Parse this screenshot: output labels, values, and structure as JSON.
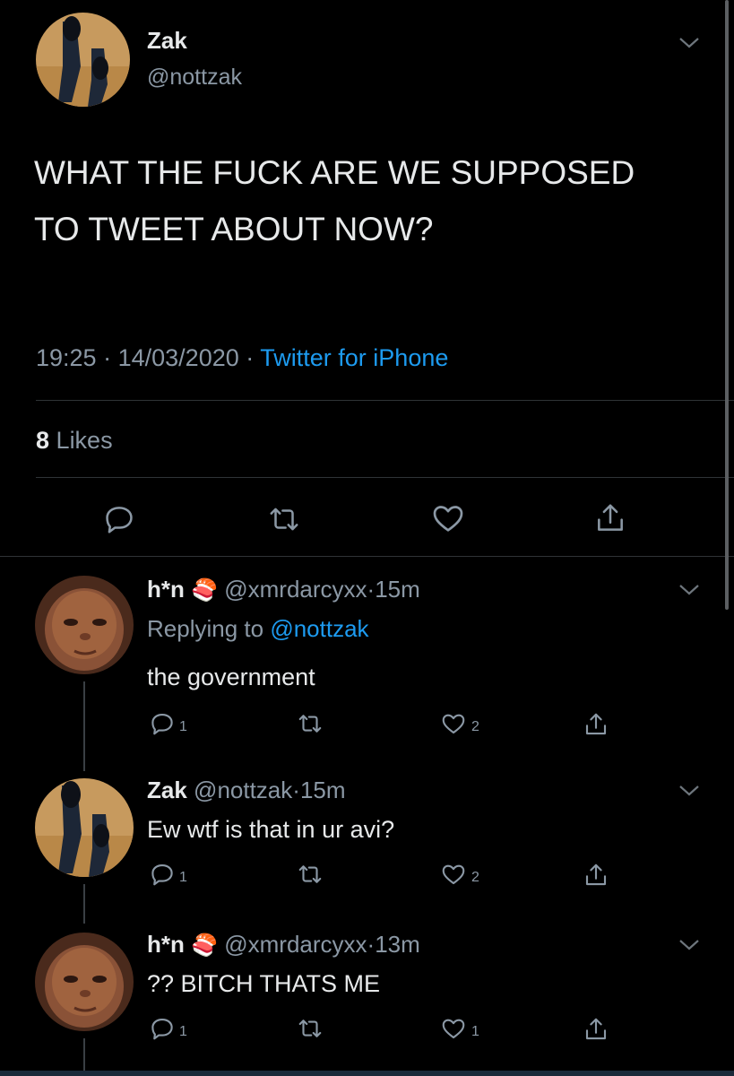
{
  "main_tweet": {
    "display_name": "Zak",
    "handle": "@nottzak",
    "text_line1": "WHAT THE FUCK ARE WE SUPPOSED",
    "text_line2": "TO TWEET ABOUT NOW?",
    "time": "19:25",
    "sep1": "·",
    "date": "14/03/2020",
    "sep2": "·",
    "source": "Twitter for iPhone",
    "likes_count": "8",
    "likes_label": "Likes"
  },
  "replies": [
    {
      "display_name": "h*n",
      "emoji": "🍣",
      "handle": "@xmrdarcyxx",
      "sep": "·",
      "time": "15m",
      "replying_prefix": "Replying to",
      "replying_to": "@nottzak",
      "text": "the government",
      "reply_count": "1",
      "like_count": "2"
    },
    {
      "display_name": "Zak",
      "handle": "@nottzak",
      "sep": "·",
      "time": "15m",
      "text": "Ew wtf is that in ur avi?",
      "reply_count": "1",
      "like_count": "2"
    },
    {
      "display_name": "h*n",
      "emoji": "🍣",
      "handle": "@xmrdarcyxx",
      "sep": "·",
      "time": "13m",
      "text": "?? BITCH THATS ME",
      "reply_count": "1",
      "like_count": "1"
    }
  ],
  "icons": {
    "reply": "reply-icon",
    "retweet": "retweet-icon",
    "like": "heart-icon",
    "share": "share-icon",
    "chevron": "chevron-down-icon"
  },
  "colors": {
    "background": "#000000",
    "link": "#1d9bf0",
    "muted": "#8b98a5",
    "text": "#d9d9d9"
  }
}
